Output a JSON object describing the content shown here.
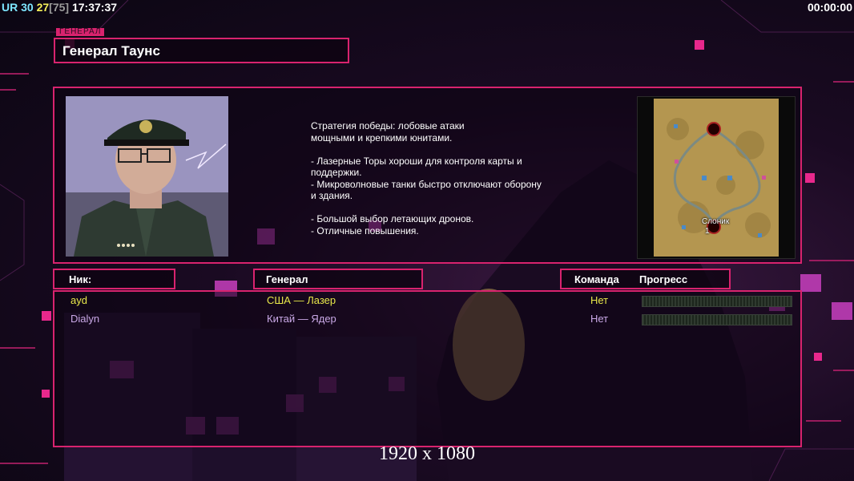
{
  "status_bar": {
    "ur": "UR",
    "fps": "30",
    "count": "27",
    "count_max": "[75]",
    "clock": "17:37:37",
    "timer": "00:00:00"
  },
  "general": {
    "tab_label": "ГЕНЕРАЛ",
    "name": "Генерал Таунс",
    "description": "Стратегия победы: лобовые атаки\nмощными и крепкими юнитами.\n\n- Лазерные Торы хороши для контроля карты и\n поддержки.\n- Микроволновые танки быстро отключают оборону\n и здания.\n\n- Большой выбор летающих дронов.\n- Отличные повышения."
  },
  "map": {
    "name": "Слоник",
    "slot": "1"
  },
  "table": {
    "headers": {
      "nick": "Ник:",
      "general": "Генерал",
      "team": "Команда",
      "progress": "Прогресс"
    },
    "rows": [
      {
        "nick": "ayd",
        "general": "США — Лазер",
        "team": "Нет",
        "progress": 0,
        "color": "#e8e84a"
      },
      {
        "nick": "Dialyn",
        "general": "Китай — Ядер",
        "team": "Нет",
        "progress": 0,
        "color": "#c9a8e6"
      }
    ]
  },
  "resolution": "1920 x 1080",
  "colors": {
    "accent": "#d8236e",
    "player1": "#e8e84a",
    "player2": "#c9a8e6"
  }
}
